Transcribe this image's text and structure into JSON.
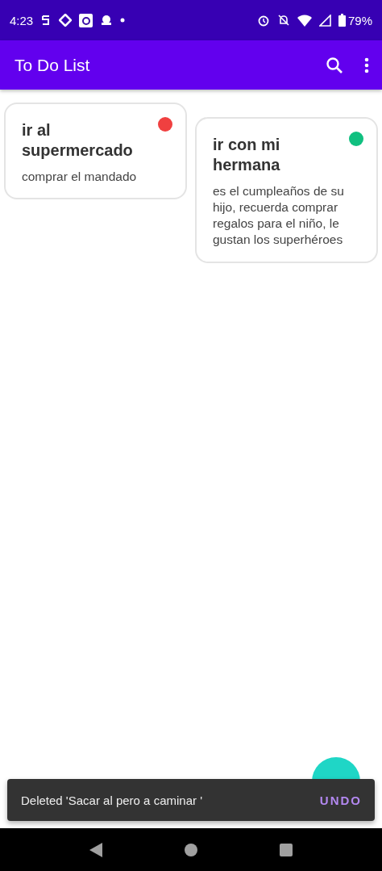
{
  "status_bar": {
    "time": "4:23",
    "battery": "79%"
  },
  "app_bar": {
    "title": "To Do List"
  },
  "notes": [
    {
      "title": "ir al supermercado",
      "body": "comprar el mandado",
      "color": "#f04040"
    },
    {
      "title": "ir con mi hermana",
      "body": "es el cumpleaños de su hijo, recuerda comprar regalos para el niño, le gustan los superhéroes",
      "color": "#10c080"
    }
  ],
  "snackbar": {
    "message": "Deleted 'Sacar al pero a caminar '",
    "action": "UNDO"
  }
}
